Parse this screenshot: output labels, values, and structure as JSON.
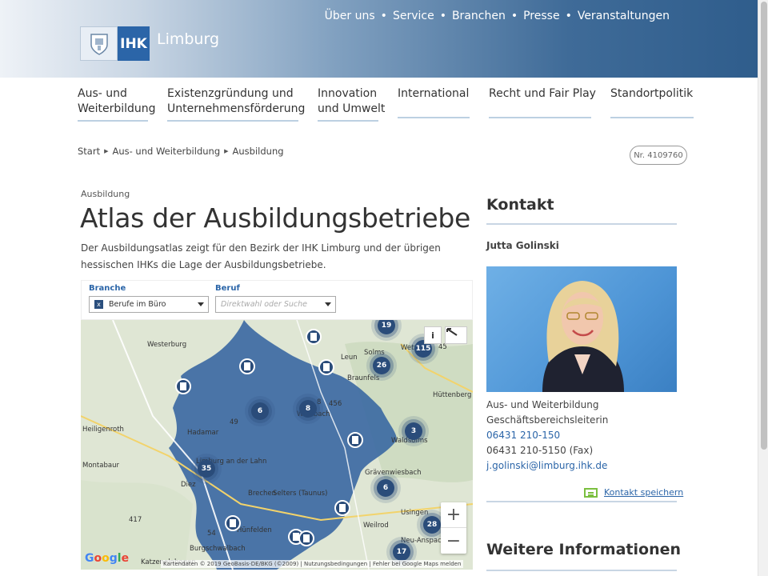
{
  "header": {
    "logo_text": "IHK",
    "logo_name": "Limburg",
    "topnav": [
      "Über uns",
      "Service",
      "Branchen",
      "Presse",
      "Veranstaltungen"
    ]
  },
  "mainnav": [
    {
      "line1": "Aus- und",
      "line2": "Weiterbildung"
    },
    {
      "line1": "Existenzgründung und",
      "line2": "Unternehmensförderung"
    },
    {
      "line1": "Innovation",
      "line2": "und Umwelt"
    },
    {
      "line1": "International",
      "line2": ""
    },
    {
      "line1": "Recht und Fair Play",
      "line2": ""
    },
    {
      "line1": "Standortpolitik",
      "line2": ""
    }
  ],
  "breadcrumb": [
    "Start",
    "Aus- und Weiterbildung",
    "Ausbildung"
  ],
  "doc_number": "Nr. 4109760",
  "content": {
    "kicker": "Ausbildung",
    "title": "Atlas der Ausbildungsbetriebe",
    "intro": "Der Ausbildungsatlas zeigt für den Bezirk der IHK Limburg und der übrigen hessischen IHKs die Lage der Ausbildungsbetriebe."
  },
  "map": {
    "filter": {
      "branche_label": "Branche",
      "branche_value": "Berufe im Büro",
      "branche_chip": "x",
      "beruf_label": "Beruf",
      "beruf_placeholder": "Direktwahl oder Suche"
    },
    "clusters": [
      "19",
      "115",
      "26",
      "6",
      "8",
      "3",
      "35",
      "6",
      "28",
      "17"
    ],
    "places": [
      "Westerburg",
      "Hadamar",
      "Montabaur",
      "Diez",
      "Weinbach",
      "Braunfels",
      "Leun",
      "Solms",
      "Hüttenberg",
      "Waldsolms",
      "Grävenwiesbach",
      "Brechen",
      "Selters (Taunus)",
      "Weilrod",
      "Usingen",
      "Neu-Anspach",
      "Hünfelden",
      "Katzenelnbogen",
      "Burgschwalbach",
      "Limburg an der Lahn",
      "Heiligenroth",
      "Wetzlar"
    ],
    "roads": [
      "417",
      "54",
      "8",
      "49",
      "45",
      "456"
    ],
    "zoom_in": "+",
    "zoom_out": "−",
    "info": "i",
    "google": "Google",
    "attribution": "Kartendaten © 2019 GeoBasis-DE/BKG (©2009)  |  Nutzungsbedingungen  |  Fehler bei Google Maps melden"
  },
  "sidebar": {
    "contact_heading": "Kontakt",
    "name": "Jutta Golinski",
    "department": "Aus- und Weiterbildung",
    "role": "Geschäftsbereichsleiterin",
    "phone": "06431 210-150",
    "fax": "06431 210-5150 (Fax)",
    "email": "j.golinski@limburg.ihk.de",
    "save_contact": "Kontakt speichern",
    "more_heading": "Weitere Informationen"
  },
  "colors": {
    "brand": "#2b65a8",
    "map_region": "#3d6aa3",
    "cluster": "#2a4c7a",
    "vcard": "#7bbf3f"
  }
}
